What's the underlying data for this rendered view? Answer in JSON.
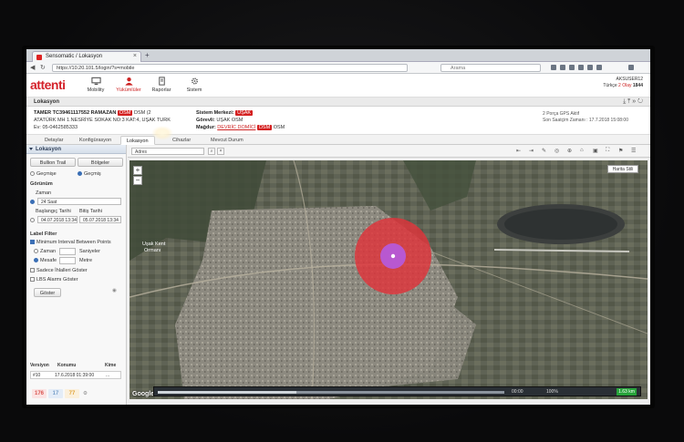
{
  "browser": {
    "tab_title": "Sensomatic / Lokasyon",
    "url": "https://10.20.101.5/login/?s=mobile",
    "search_placeholder": "Arama"
  },
  "app": {
    "logo": "attenti",
    "nav": [
      {
        "label": "Mobility",
        "icon": "monitor-icon",
        "active": false
      },
      {
        "label": "Yükümlüler",
        "icon": "user-icon",
        "active": true
      },
      {
        "label": "Raporlar",
        "icon": "report-icon",
        "active": false
      },
      {
        "label": "Sistem",
        "icon": "gear-icon",
        "active": false
      }
    ],
    "user": {
      "name": "AKSUSER12",
      "lang": "Türkçe",
      "badge": "2 Olay",
      "count": "1844"
    }
  },
  "page": {
    "title": "Lokasyon"
  },
  "vehicle": {
    "name_line": "TAMER TC39461117552 RAMAZAN",
    "name_tag": "OSM",
    "status_suffix": "DSM (2",
    "address": "ATATÜRK MH 1.NESRİYE SOKAK NO:3 KAT:4, UŞAK TURK",
    "phone": "Ev: 05-0462585333",
    "center_label": "Sistem Merkezi:",
    "center_value": "UŞAK",
    "officer_label": "Görevli:",
    "officer_value": "UŞAK OSM",
    "court_label": "Mağdur:",
    "court_value": "DEVRİC DOMİCİ",
    "court_tag": "DSM",
    "court_suffix": "OSM",
    "gps_title": "2 Porça GPS Aktif",
    "gps_time": "Son Saatçim Zamanı : 17.7.2018 15:08:00"
  },
  "vtabs": [
    "Detaylar",
    "Konfigürasyon",
    "Lokasyon",
    "Cihazlar",
    "Mevcut Durum"
  ],
  "vtab_active": 2,
  "sidebar": {
    "header": "Lokasyon",
    "btn_trail": "Bullion Trail",
    "btn_regions": "Bölgeler",
    "radio_past": "Geçmişe",
    "radio_live": "Geçmiş",
    "view_label": "Görünüm",
    "period_label": "Zaman",
    "period_value": "24 Saat",
    "start_label": "Başlangıç Tarihi",
    "end_label": "Bitiş Tarihi",
    "start_value": "04.07.2018",
    "start_time": "13:34",
    "end_value": "05.07.2018",
    "end_time": "13:34",
    "filter_label": "Label Filter",
    "filter_min": "Minimum Interval Between Points",
    "opt_time": "Zaman",
    "opt_time_unit": "Saniyeler",
    "opt_dist": "Mesafe",
    "opt_dist_unit": "Metre",
    "chk_violations": "Sadece İhlalleri Göster",
    "chk_lbs": "LBS Alarmı Göster",
    "show_btn": "Göster",
    "table_headers": [
      "Versiyon",
      "Konumu",
      "Kime"
    ],
    "table_row": [
      "#10",
      "17.6.2018 01:39:00",
      "..."
    ],
    "counts": [
      {
        "value": "176",
        "color": "#d9534f"
      },
      {
        "value": "17",
        "color": "#7aa0c9"
      },
      {
        "value": "77",
        "color": "#e0a43a"
      }
    ]
  },
  "map": {
    "search_placeholder": "Adres",
    "btn_layer": "Harita Stili",
    "zoom_in": "+",
    "zoom_out": "−",
    "google": "Google",
    "labels": [
      {
        "text": "Uşak Kent",
        "color": "#fff"
      },
      {
        "text": "Ormanı",
        "color": "#fff"
      }
    ],
    "timeline_left": "00:00",
    "timeline_mid": "100%",
    "timeline_speed": "1.63 km"
  },
  "colors": {
    "brand": "#d4232b",
    "radius_fill": "#e0333b",
    "point": "#b65ad8"
  }
}
